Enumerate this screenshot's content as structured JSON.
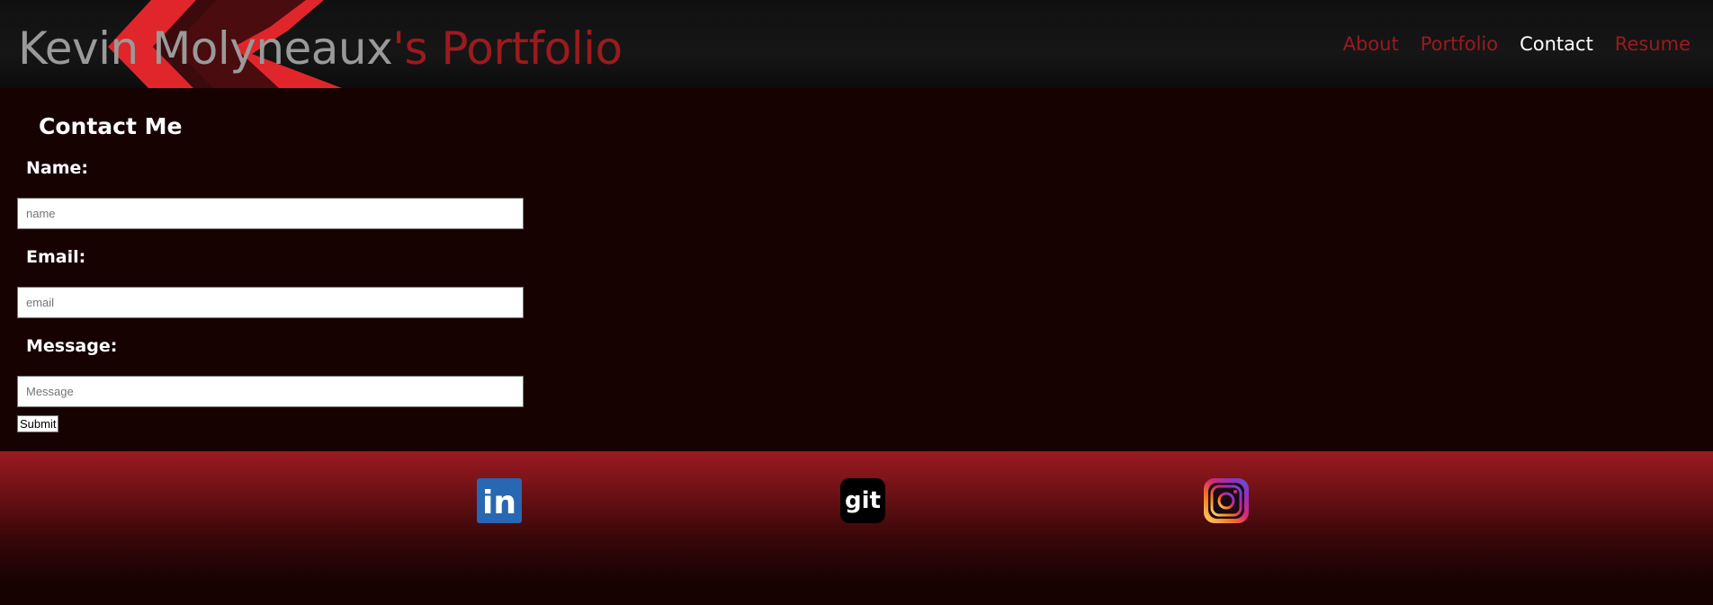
{
  "header": {
    "title_name": "Kevin Molyneaux",
    "title_rest": "'s Portfolio",
    "nav": [
      {
        "label": "About",
        "active": false
      },
      {
        "label": "Portfolio",
        "active": false
      },
      {
        "label": "Contact",
        "active": true
      },
      {
        "label": "Resume",
        "active": false
      }
    ]
  },
  "contact": {
    "heading": "Contact Me",
    "name_label": "Name:",
    "name_placeholder": "name",
    "email_label": "Email:",
    "email_placeholder": "email",
    "message_label": "Message:",
    "message_placeholder": "Message",
    "submit_label": "Submit"
  },
  "footer": {
    "social": [
      {
        "icon": "linkedin-icon",
        "glyph": "in",
        "color": "#2867b2"
      },
      {
        "icon": "github-icon",
        "glyph": "git",
        "color": "#000000"
      },
      {
        "icon": "instagram-icon",
        "color": "#c13584"
      }
    ]
  },
  "colors": {
    "background": "#170202",
    "accent_red": "#9c1a1e",
    "header_art_red": "#e0262b",
    "title_gray": "#9a9a9a"
  }
}
